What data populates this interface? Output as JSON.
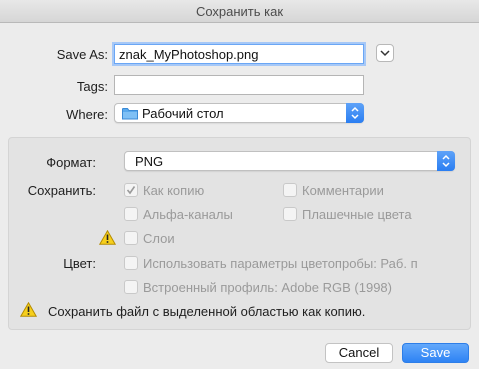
{
  "window": {
    "title": "Сохранить как"
  },
  "save_as": {
    "label": "Save As:",
    "value": "znak_MyPhotoshop.png"
  },
  "tags": {
    "label": "Tags:",
    "value": ""
  },
  "where": {
    "label": "Where:",
    "value": "Рабочий стол",
    "icon": "folder-icon"
  },
  "options": {
    "format_label": "Формат:",
    "format_value": "PNG",
    "save_label": "Сохранить:",
    "checkboxes": {
      "as_copy": {
        "label": "Как копию",
        "checked": true
      },
      "comments": {
        "label": "Комментарии",
        "checked": false
      },
      "alpha": {
        "label": "Альфа-каналы",
        "checked": false
      },
      "spot": {
        "label": "Плашечные цвета",
        "checked": false
      },
      "layers": {
        "label": "Слои",
        "checked": false
      },
      "proof": {
        "label": "Использовать параметры цветопробы:  Раб. п",
        "checked": false
      },
      "profile": {
        "label": "Встроенный профиль:  Adobe RGB (1998)",
        "checked": false
      }
    },
    "color_label": "Цвет:",
    "warning_text": "Сохранить файл с выделенной областью как копию."
  },
  "buttons": {
    "cancel": "Cancel",
    "save": "Save"
  },
  "colors": {
    "accent": "#2e83f4",
    "warning": "#f6cf1c",
    "folder": "#5aa9ec"
  }
}
